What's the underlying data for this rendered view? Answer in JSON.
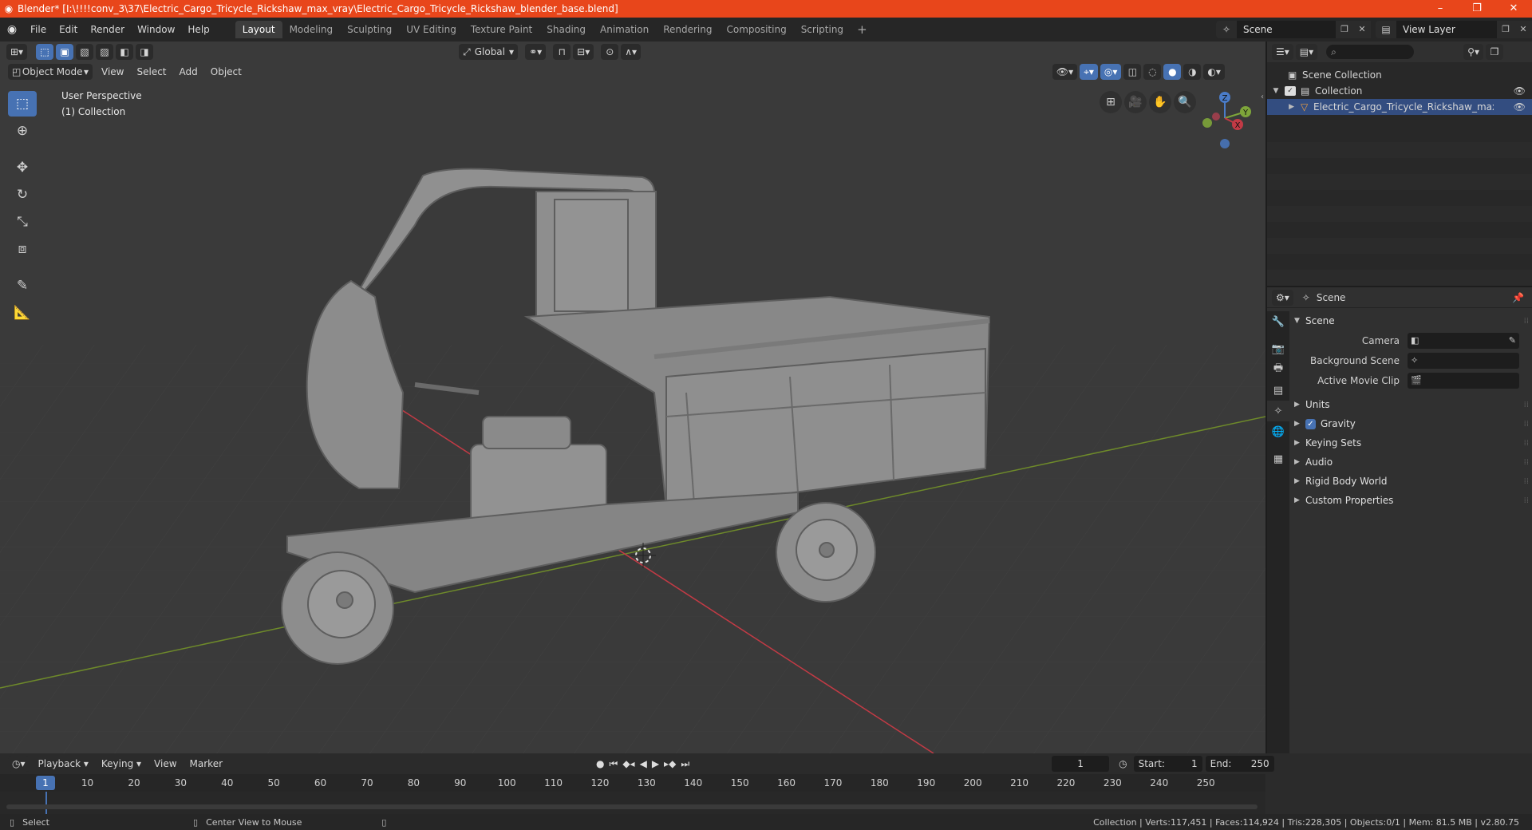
{
  "window": {
    "title": "Blender* [I:\\!!!!conv_3\\37\\Electric_Cargo_Tricycle_Rickshaw_max_vray\\Electric_Cargo_Tricycle_Rickshaw_blender_base.blend]",
    "minimize": "–",
    "maximize": "❐",
    "close": "✕"
  },
  "menu": {
    "items": [
      "File",
      "Edit",
      "Render",
      "Window",
      "Help"
    ]
  },
  "workspaces": {
    "tabs": [
      "Layout",
      "Modeling",
      "Sculpting",
      "UV Editing",
      "Texture Paint",
      "Shading",
      "Animation",
      "Rendering",
      "Compositing",
      "Scripting"
    ],
    "active": "Layout",
    "add": "+"
  },
  "scene_selector": {
    "value": "Scene"
  },
  "view_layer_selector": {
    "value": "View Layer"
  },
  "viewport": {
    "mode": "Object Mode",
    "menus": [
      "View",
      "Select",
      "Add",
      "Object"
    ],
    "orientation": "Global",
    "info_line1": "User Perspective",
    "info_line2": "(1) Collection",
    "gizmo": {
      "z": "Z",
      "y": "Y",
      "x": "X"
    },
    "colors": {
      "x_axis": "#c23a45",
      "y_axis": "#6e8a2a",
      "bg": "#3a3a3a"
    }
  },
  "outliner": {
    "search_placeholder": "",
    "rows": [
      {
        "label": "Scene Collection"
      },
      {
        "label": "Collection"
      },
      {
        "label": "Electric_Cargo_Tricycle_Rickshaw_max_con"
      }
    ]
  },
  "properties": {
    "context": "Scene",
    "panel_title": "Scene",
    "camera_label": "Camera",
    "background_scene_label": "Background Scene",
    "active_movie_clip_label": "Active Movie Clip",
    "panels": [
      "Units",
      "Gravity",
      "Keying Sets",
      "Audio",
      "Rigid Body World",
      "Custom Properties"
    ]
  },
  "timeline": {
    "menus": [
      "Playback",
      "Keying",
      "View",
      "Marker"
    ],
    "current_frame": "1",
    "start_label": "Start:",
    "start": "1",
    "end_label": "End:",
    "end": "250",
    "ruler": [
      "1",
      "10",
      "20",
      "30",
      "40",
      "50",
      "60",
      "70",
      "80",
      "90",
      "100",
      "110",
      "120",
      "130",
      "140",
      "150",
      "160",
      "170",
      "180",
      "190",
      "200",
      "210",
      "220",
      "230",
      "240",
      "250"
    ]
  },
  "statusbar": {
    "select": "Select",
    "center_view": "Center View to Mouse",
    "stats": "Collection | Verts:117,451 | Faces:114,924 | Tris:228,305 | Objects:0/1 | Mem: 81.5 MB | v2.80.75"
  }
}
